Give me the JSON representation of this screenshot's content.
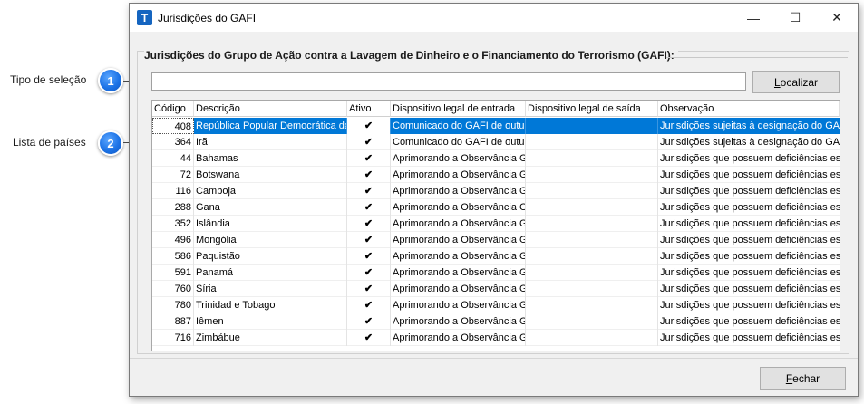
{
  "callouts": [
    {
      "number": "1",
      "label": "Tipo de seleção"
    },
    {
      "number": "2",
      "label": "Lista de países"
    }
  ],
  "window": {
    "icon_letter": "T",
    "title": "Jurisdições do GAFI",
    "minimize": "—",
    "maximize": "☐",
    "close": "✕"
  },
  "group": {
    "title": "Jurisdições do Grupo de Ação contra a Lavagem de Dinheiro e o Financiamento do Terrorismo (GAFI):"
  },
  "search": {
    "value": "",
    "placeholder": ""
  },
  "buttons": {
    "localizar": "Localizar",
    "fechar": "Fechar"
  },
  "table": {
    "columns": [
      "Código",
      "Descrição",
      "Ativo",
      "Dispositivo legal de entrada",
      "Dispositivo legal de saída",
      "Observação"
    ],
    "rows": [
      {
        "codigo": "408",
        "descricao": "República Popular Democrática da",
        "ativo": true,
        "entrada": "Comunicado do GAFI de outub",
        "saida": "",
        "obs": "Jurisdições sujeitas à designação do GAF"
      },
      {
        "codigo": "364",
        "descricao": "Irã",
        "ativo": true,
        "entrada": "Comunicado do GAFI de outub",
        "saida": "",
        "obs": "Jurisdições sujeitas à designação do GAF"
      },
      {
        "codigo": "44",
        "descricao": "Bahamas",
        "ativo": true,
        "entrada": "Aprimorando a Observância G",
        "saida": "",
        "obs": "Jurisdições que possuem deficiências estı"
      },
      {
        "codigo": "72",
        "descricao": "Botswana",
        "ativo": true,
        "entrada": "Aprimorando a Observância G",
        "saida": "",
        "obs": "Jurisdições que possuem deficiências estı"
      },
      {
        "codigo": "116",
        "descricao": "Camboja",
        "ativo": true,
        "entrada": "Aprimorando a Observância G",
        "saida": "",
        "obs": "Jurisdições que possuem deficiências estı"
      },
      {
        "codigo": "288",
        "descricao": "Gana",
        "ativo": true,
        "entrada": "Aprimorando a Observância G",
        "saida": "",
        "obs": "Jurisdições que possuem deficiências estı"
      },
      {
        "codigo": "352",
        "descricao": "Islândia",
        "ativo": true,
        "entrada": "Aprimorando a Observância G",
        "saida": "",
        "obs": "Jurisdições que possuem deficiências estı"
      },
      {
        "codigo": "496",
        "descricao": "Mongólia",
        "ativo": true,
        "entrada": "Aprimorando a Observância G",
        "saida": "",
        "obs": "Jurisdições que possuem deficiências estı"
      },
      {
        "codigo": "586",
        "descricao": "Paquistão",
        "ativo": true,
        "entrada": "Aprimorando a Observância G",
        "saida": "",
        "obs": "Jurisdições que possuem deficiências estı"
      },
      {
        "codigo": "591",
        "descricao": "Panamá",
        "ativo": true,
        "entrada": "Aprimorando a Observância G",
        "saida": "",
        "obs": "Jurisdições que possuem deficiências estı"
      },
      {
        "codigo": "760",
        "descricao": "Síria",
        "ativo": true,
        "entrada": "Aprimorando a Observância G",
        "saida": "",
        "obs": "Jurisdições que possuem deficiências estı"
      },
      {
        "codigo": "780",
        "descricao": "Trinidad e Tobago",
        "ativo": true,
        "entrada": "Aprimorando a Observância G",
        "saida": "",
        "obs": "Jurisdições que possuem deficiências estı"
      },
      {
        "codigo": "887",
        "descricao": "Iêmen",
        "ativo": true,
        "entrada": "Aprimorando a Observância G",
        "saida": "",
        "obs": "Jurisdições que possuem deficiências estı"
      },
      {
        "codigo": "716",
        "descricao": "Zimbábue",
        "ativo": true,
        "entrada": "Aprimorando a Observância G",
        "saida": "",
        "obs": "Jurisdições que possuem deficiências estı"
      }
    ],
    "selected_index": 0,
    "check_glyph": "✔"
  },
  "colors": {
    "selection": "#0078d7",
    "badge": "#1d73e6",
    "app_icon": "#1565c0"
  }
}
